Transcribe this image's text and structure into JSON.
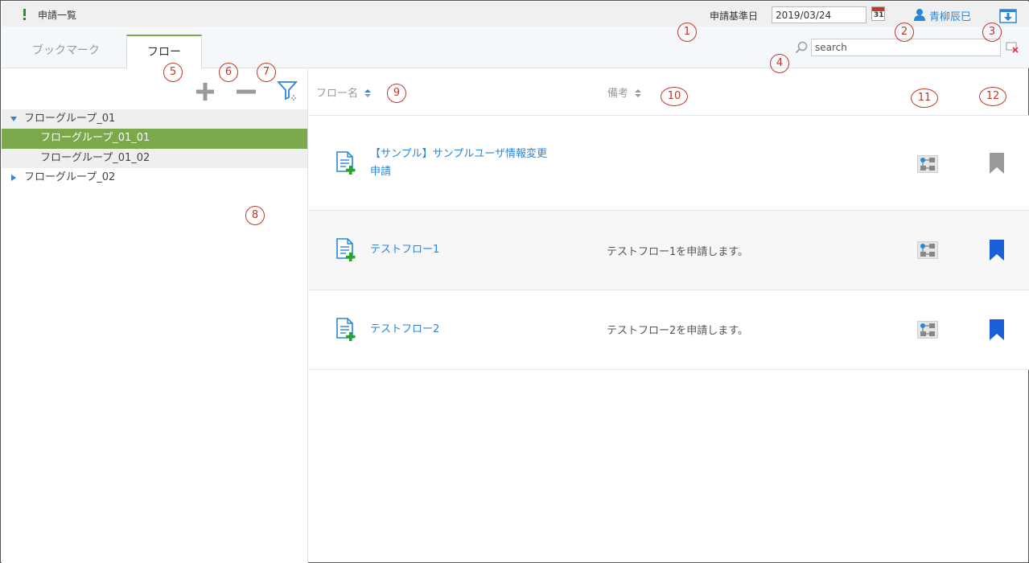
{
  "header": {
    "title": "申請一覧",
    "date_label": "申請基準日",
    "date_value": "2019/03/24",
    "calendar_day": "31",
    "user_name": "青柳辰巳"
  },
  "tabs": [
    {
      "label": "ブックマーク",
      "active": false
    },
    {
      "label": "フロー",
      "active": true
    }
  ],
  "search": {
    "placeholder": "search"
  },
  "tree": {
    "groups": [
      {
        "label": "フローグループ_01",
        "expanded": true,
        "children": [
          {
            "label": "フローグループ_01_01",
            "selected": true
          },
          {
            "label": "フローグループ_01_02",
            "selected": false
          }
        ]
      },
      {
        "label": "フローグループ_02",
        "expanded": false
      }
    ]
  },
  "columns": {
    "flow_name": "フロー名",
    "note": "備考"
  },
  "flows": [
    {
      "name_line1": "【サンプル】サンプルユーザ情報変更",
      "name_line2": "申請",
      "note": "",
      "bookmarked": false
    },
    {
      "name_line1": "テストフロー1",
      "name_line2": "",
      "note": "テストフロー1を申請します。",
      "bookmarked": true
    },
    {
      "name_line1": "テストフロー2",
      "name_line2": "",
      "note": "テストフロー2を申請します。",
      "bookmarked": true
    }
  ],
  "annotations": [
    "1",
    "2",
    "3",
    "4",
    "5",
    "6",
    "7",
    "8",
    "9",
    "10",
    "11",
    "12"
  ],
  "colors": {
    "accent_green": "#7aa84a",
    "link_blue": "#2a86d9",
    "bookmark_on": "#1a5fd8",
    "bookmark_off": "#999999",
    "annotation_red": "#c0392b"
  }
}
